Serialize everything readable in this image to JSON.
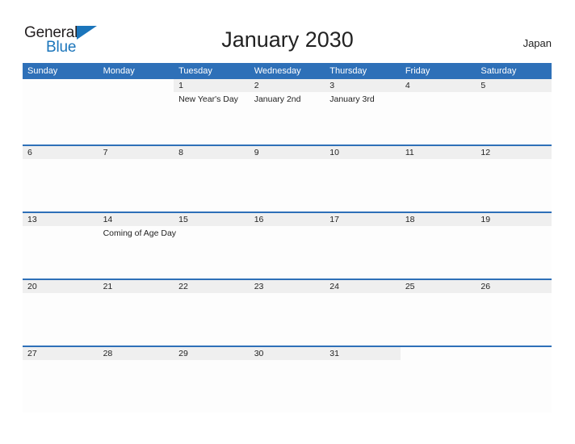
{
  "brand": {
    "word_one": "General",
    "word_two": "Blue",
    "flag_icon": "triangle-flag-icon",
    "accent_color": "#1b75bb"
  },
  "header": {
    "title": "January 2030",
    "country": "Japan"
  },
  "theme": {
    "header_blue": "#2e70b8",
    "daynum_band": "#efefef",
    "cell_background": "#fdfdfd",
    "text": "#222222"
  },
  "calendar": {
    "weekday_headers": [
      "Sunday",
      "Monday",
      "Tuesday",
      "Wednesday",
      "Thursday",
      "Friday",
      "Saturday"
    ],
    "weeks": [
      {
        "days": [
          {
            "number": "",
            "event": ""
          },
          {
            "number": "",
            "event": ""
          },
          {
            "number": "1",
            "event": "New Year's Day"
          },
          {
            "number": "2",
            "event": "January 2nd"
          },
          {
            "number": "3",
            "event": "January 3rd"
          },
          {
            "number": "4",
            "event": ""
          },
          {
            "number": "5",
            "event": ""
          }
        ]
      },
      {
        "days": [
          {
            "number": "6",
            "event": ""
          },
          {
            "number": "7",
            "event": ""
          },
          {
            "number": "8",
            "event": ""
          },
          {
            "number": "9",
            "event": ""
          },
          {
            "number": "10",
            "event": ""
          },
          {
            "number": "11",
            "event": ""
          },
          {
            "number": "12",
            "event": ""
          }
        ]
      },
      {
        "days": [
          {
            "number": "13",
            "event": ""
          },
          {
            "number": "14",
            "event": "Coming of Age Day"
          },
          {
            "number": "15",
            "event": ""
          },
          {
            "number": "16",
            "event": ""
          },
          {
            "number": "17",
            "event": ""
          },
          {
            "number": "18",
            "event": ""
          },
          {
            "number": "19",
            "event": ""
          }
        ]
      },
      {
        "days": [
          {
            "number": "20",
            "event": ""
          },
          {
            "number": "21",
            "event": ""
          },
          {
            "number": "22",
            "event": ""
          },
          {
            "number": "23",
            "event": ""
          },
          {
            "number": "24",
            "event": ""
          },
          {
            "number": "25",
            "event": ""
          },
          {
            "number": "26",
            "event": ""
          }
        ]
      },
      {
        "days": [
          {
            "number": "27",
            "event": ""
          },
          {
            "number": "28",
            "event": ""
          },
          {
            "number": "29",
            "event": ""
          },
          {
            "number": "30",
            "event": ""
          },
          {
            "number": "31",
            "event": ""
          },
          {
            "number": "",
            "event": ""
          },
          {
            "number": "",
            "event": ""
          }
        ]
      }
    ]
  }
}
